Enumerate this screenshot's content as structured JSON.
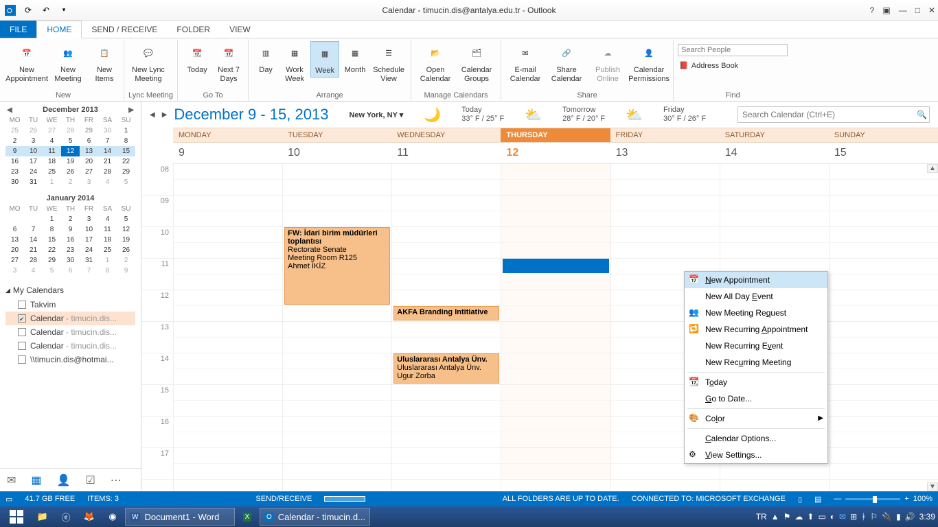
{
  "title": "Calendar - timucin.dis@antalya.edu.tr - Outlook",
  "tabs": {
    "file": "FILE",
    "home": "HOME",
    "sendrecv": "SEND / RECEIVE",
    "folder": "FOLDER",
    "view": "VIEW"
  },
  "ribbon": {
    "new": {
      "label": "New",
      "appt": "New Appointment",
      "meeting": "New Meeting",
      "items": "New Items"
    },
    "lync": {
      "label": "Lync Meeting",
      "btn": "New Lync Meeting"
    },
    "goto": {
      "label": "Go To",
      "today": "Today",
      "next7": "Next 7 Days"
    },
    "arrange": {
      "label": "Arrange",
      "day": "Day",
      "workweek": "Work Week",
      "week": "Week",
      "month": "Month",
      "schedule": "Schedule View"
    },
    "manage": {
      "label": "Manage Calendars",
      "open": "Open Calendar",
      "groups": "Calendar Groups"
    },
    "share": {
      "label": "Share",
      "email": "E-mail Calendar",
      "share": "Share Calendar",
      "publish": "Publish Online",
      "perm": "Calendar Permissions"
    },
    "find": {
      "label": "Find",
      "search_ph": "Search People",
      "abook": "Address Book"
    }
  },
  "minical1": {
    "title": "December 2013",
    "dn": [
      "MO",
      "TU",
      "WE",
      "TH",
      "FR",
      "SA",
      "SU"
    ]
  },
  "minical2": {
    "title": "January 2014"
  },
  "mycals": {
    "hdr": "My Calendars",
    "items": [
      {
        "name": "Takvim",
        "checked": false,
        "suffix": ""
      },
      {
        "name": "Calendar",
        "checked": true,
        "suffix": " - timucin.dis..."
      },
      {
        "name": "Calendar",
        "checked": false,
        "suffix": " - timucin.dis..."
      },
      {
        "name": "Calendar",
        "checked": false,
        "suffix": " - timucin.dis..."
      },
      {
        "name": "\\\\timucin.dis@hotmai...",
        "checked": false,
        "suffix": ""
      }
    ]
  },
  "range": "December 9 - 15, 2013",
  "loc": "New York, NY",
  "weather": [
    {
      "label": "Today",
      "temp": "33° F / 25° F"
    },
    {
      "label": "Tomorrow",
      "temp": "28° F / 20° F"
    },
    {
      "label": "Friday",
      "temp": "30° F / 26° F"
    }
  ],
  "searchcal_ph": "Search Calendar (Ctrl+E)",
  "days": [
    "MONDAY",
    "TUESDAY",
    "WEDNESDAY",
    "THURSDAY",
    "FRIDAY",
    "SATURDAY",
    "SUNDAY"
  ],
  "dates": [
    "9",
    "10",
    "11",
    "12",
    "13",
    "14",
    "15"
  ],
  "hours": [
    "08",
    "09",
    "10",
    "11",
    "12",
    "13",
    "14",
    "15",
    "16",
    "17"
  ],
  "events": {
    "tue": {
      "title": "FW: İdari birim müdürleri toplantısı",
      "l1": "Rectorate Senate",
      "l2": "Meeting Room R125",
      "l3": "Ahmet İKİZ"
    },
    "wed1": "AKFA Branding Intitiative",
    "wed2": {
      "title": "Uluslararası Antalya Ünv.",
      "l1": "Uluslararası Antalya Ünv.",
      "l2": "Ugur Zorba"
    }
  },
  "ctx": {
    "new_appt": "New Appointment",
    "new_allday": "New All Day Event",
    "new_meeting": "New Meeting Request",
    "new_rec_appt": "New Recurring Appointment",
    "new_rec_event": "New Recurring Event",
    "new_rec_meeting": "New Recurring Meeting",
    "today": "Today",
    "goto": "Go to Date...",
    "color": "Color",
    "options": "Calendar Options...",
    "viewset": "View Settings..."
  },
  "status": {
    "free": "41.7 GB FREE",
    "items": "ITEMS: 3",
    "sendrecv": "SEND/RECEIVE",
    "folders": "ALL FOLDERS ARE UP TO DATE.",
    "connected": "CONNECTED TO: MICROSOFT EXCHANGE",
    "zoom": "100%"
  },
  "taskbar": {
    "word": "Document1 - Word",
    "outlook": "Calendar - timucin.d...",
    "lang": "TR",
    "time": "3:39"
  }
}
